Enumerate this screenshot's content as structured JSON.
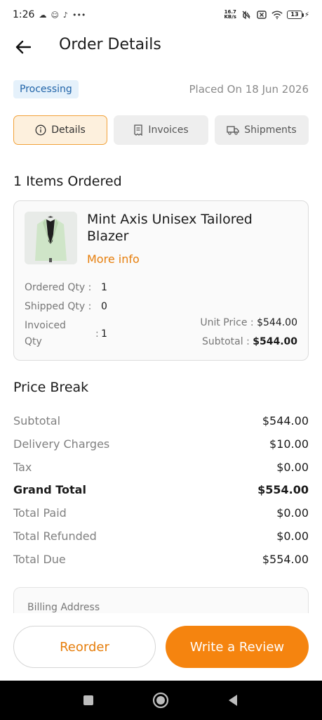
{
  "status_bar": {
    "time": "1:26",
    "net_speed_value": "16.7",
    "net_speed_unit": "KB/s",
    "battery": "13",
    "left_icons": [
      "cloud-icon",
      "face-icon",
      "tiktok-icon",
      "more-dots-icon"
    ],
    "right_icons": [
      "mute-icon",
      "sim-x-icon",
      "wifi-icon",
      "battery-icon",
      "charging-icon"
    ]
  },
  "header": {
    "title": "Order Details",
    "back_icon": "arrow-left-icon"
  },
  "order": {
    "status": "Processing",
    "placed_on": "Placed On 18 Jun 2026"
  },
  "tabs": [
    {
      "label": "Details",
      "icon": "info-icon",
      "active": true
    },
    {
      "label": "Invoices",
      "icon": "receipt-icon",
      "active": false
    },
    {
      "label": "Shipments",
      "icon": "truck-icon",
      "active": false
    }
  ],
  "items_section": {
    "title": "1 Items Ordered"
  },
  "item": {
    "name": "Mint Axis Unisex Tailored Blazer",
    "more_info": "More info",
    "ordered_qty_label": "Ordered Qty :",
    "ordered_qty": "1",
    "shipped_qty_label": "Shipped Qty :",
    "shipped_qty": "0",
    "invoiced_qty_label_1": "Invoiced",
    "invoiced_qty_label_2": "Qty",
    "invoiced_qty_sep": ":",
    "invoiced_qty": "1",
    "unit_price_label": "Unit Price :",
    "unit_price": "$544.00",
    "subtotal_label": "Subtotal :",
    "subtotal": "$544.00"
  },
  "price_break": {
    "title": "Price Break",
    "rows": [
      {
        "label": "Subtotal",
        "value": "$544.00"
      },
      {
        "label": "Delivery Charges",
        "value": "$10.00"
      },
      {
        "label": "Tax",
        "value": "$0.00"
      },
      {
        "label": "Grand Total",
        "value": "$554.00"
      },
      {
        "label": "Total Paid",
        "value": "$0.00"
      },
      {
        "label": "Total Refunded",
        "value": "$0.00"
      },
      {
        "label": "Total Due",
        "value": "$554.00"
      }
    ]
  },
  "billing": {
    "title": "Billing Address"
  },
  "footer": {
    "reorder": "Reorder",
    "review": "Write a Review"
  },
  "colors": {
    "accent": "#f5840f",
    "accent_text": "#e67e0c",
    "badge_bg": "#e5f1fb",
    "badge_text": "#1f63a8"
  }
}
